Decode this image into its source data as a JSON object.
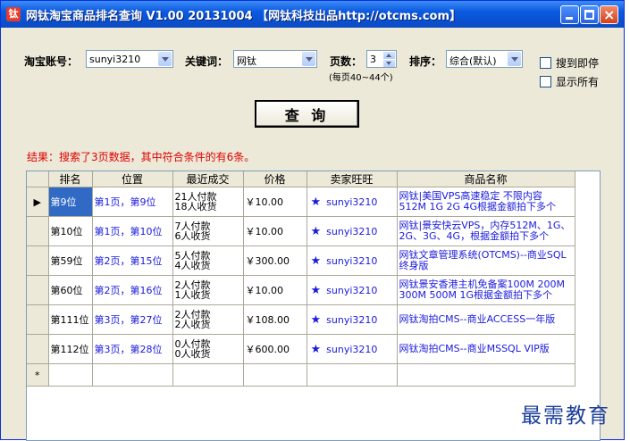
{
  "window": {
    "title": "网钛淘宝商品排名查询 V1.00 20131004 【网钛科技出品http://otcms.com】",
    "icon_text": "钛"
  },
  "form": {
    "account_label": "淘宝账号：",
    "account_value": "sunyi3210",
    "keyword_label": "关键词：",
    "keyword_value": "网钛",
    "pages_label": "页数：",
    "pages_value": "3",
    "pages_note": "(每页40~44个)",
    "sort_label": "排序：",
    "sort_value": "综合(默认)",
    "stop_on_found_label": "搜到即停",
    "show_all_label": "显示所有",
    "query_button": "查 询"
  },
  "result_text": "结果：搜索了3页数据，其中符合条件的有6条。",
  "grid": {
    "columns": [
      "排名",
      "位置",
      "最近成交",
      "价格",
      "卖家旺旺",
      "商品名称"
    ],
    "rows": [
      {
        "rank": "第9位",
        "position": "第1页，第9位",
        "deal1": "21人付款",
        "deal2": "18人收货",
        "price": "￥10.00",
        "seller": "sunyi3210",
        "name": "网钛|美国VPS高速稳定 不限内容 512M 1G 2G 4G根据金额拍下多个"
      },
      {
        "rank": "第10位",
        "position": "第1页，第10位",
        "deal1": "7人付款",
        "deal2": "6人收货",
        "price": "￥10.00",
        "seller": "sunyi3210",
        "name": "网钛|景安快云VPS，内存512M、1G、2G、3G、4G，根据金额拍下多个"
      },
      {
        "rank": "第59位",
        "position": "第2页，第15位",
        "deal1": "5人付款",
        "deal2": "4人收货",
        "price": "￥300.00",
        "seller": "sunyi3210",
        "name": "网钛文章管理系统(OTCMS)--商业SQL终身版"
      },
      {
        "rank": "第60位",
        "position": "第2页，第16位",
        "deal1": "2人付款",
        "deal2": "1人收货",
        "price": "￥10.00",
        "seller": "sunyi3210",
        "name": "网钛景安香港主机免备案100M 200M 300M 500M 1G根据金额拍下多个"
      },
      {
        "rank": "第111位",
        "position": "第3页，第27位",
        "deal1": "2人付款",
        "deal2": "2人收货",
        "price": "￥108.00",
        "seller": "sunyi3210",
        "name": "网钛淘拍CMS--商业ACCESS一年版"
      },
      {
        "rank": "第112位",
        "position": "第3页，第28位",
        "deal1": "0人付款",
        "deal2": "0人收货",
        "price": "￥600.00",
        "seller": "sunyi3210",
        "name": "网钛淘拍CMS--商业MSSQL VIP版"
      }
    ],
    "current_row_marker": "▶",
    "new_row_marker": "*"
  },
  "watermark": "最需教育",
  "colors": {
    "titlebar": "#0b5ae0",
    "result_text": "#e00000",
    "link_blue": "#1a1adc",
    "selection": "#316ac5"
  }
}
